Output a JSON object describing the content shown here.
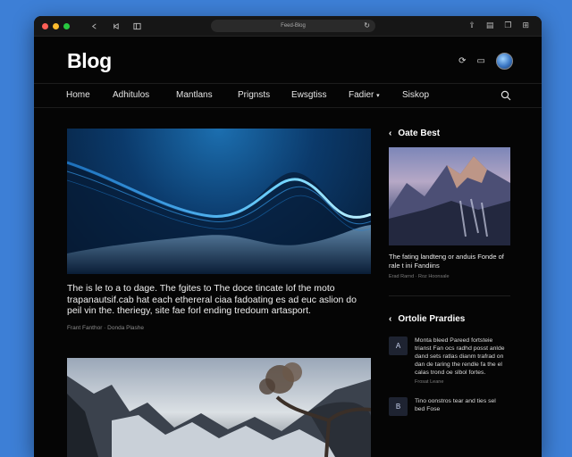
{
  "browser": {
    "url": "Feed-Blog"
  },
  "header": {
    "logo": "Blog"
  },
  "nav": {
    "items": [
      "Home",
      "Adhitulos",
      "Mantlans",
      "Prignsts",
      "Ewsgtiss",
      "Fadier",
      "Siskop"
    ]
  },
  "main": {
    "featured": {
      "title": "The is le to a to dage. The fgites to The doce tincate lof the moto trapanautsif.cab hat each ethereral ciaa fadoating es ad euc aslion do peil vin the. theriegy, site fae forl ending tredoum artasport.",
      "meta": "Frant Fanthor · Donda Plashe"
    }
  },
  "sidebar": {
    "section1": {
      "title": "Oate Best",
      "article": {
        "title": "The fating landteng or anduis Fonde of rale t ini Fandiins",
        "meta": "Erad Rarnd · Roz Hoonsale"
      }
    },
    "section2": {
      "title": "Ortolie Prardies",
      "posts": [
        {
          "badge": "A",
          "text": "Monta bleed Pareed fortsteie trianst Fan ocs radhd posst anlde dand sets ratlas dianm trafrad on dan de taring the rendle fa the el calas trond oe slbol fortes.",
          "meta": "Frosat Leane"
        },
        {
          "badge": "B",
          "text": "Tino oonstros tear and ties sel bed Fose",
          "meta": ""
        }
      ]
    }
  },
  "colors": {
    "background": "#3d7fd6",
    "window": "#050505",
    "accent": "#38b6ff"
  }
}
